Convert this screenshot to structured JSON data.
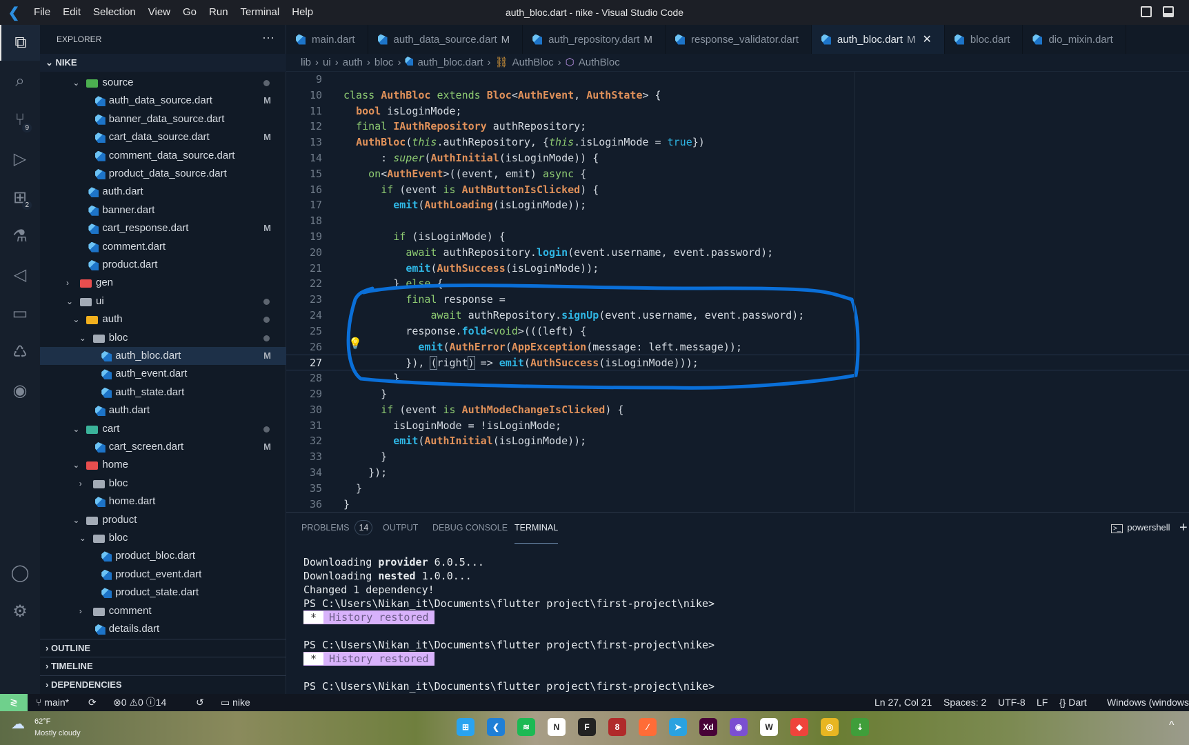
{
  "titlebar": {
    "menu": [
      "File",
      "Edit",
      "Selection",
      "View",
      "Go",
      "Run",
      "Terminal",
      "Help"
    ],
    "title": "auth_bloc.dart - nike - Visual Studio Code"
  },
  "activity": {
    "items": [
      {
        "name": "explorer",
        "glyph": "⧉",
        "active": true
      },
      {
        "name": "search",
        "glyph": "⌕"
      },
      {
        "name": "source-control",
        "glyph": "⑂",
        "badge": "9"
      },
      {
        "name": "run-debug",
        "glyph": "▷"
      },
      {
        "name": "extensions",
        "glyph": "⊞",
        "badge": "2"
      },
      {
        "name": "testing",
        "glyph": "⚗"
      },
      {
        "name": "flutter",
        "glyph": "◁"
      },
      {
        "name": "folder",
        "glyph": "▭"
      },
      {
        "name": "remote-explorer",
        "glyph": "♺"
      },
      {
        "name": "github",
        "glyph": "◉"
      }
    ],
    "bottom": [
      {
        "name": "account",
        "glyph": "◯"
      },
      {
        "name": "settings",
        "glyph": "⚙"
      }
    ]
  },
  "sidebar": {
    "title": "EXPLORER",
    "more": "···",
    "root": "NIKE",
    "tree": [
      {
        "label": "source",
        "depth": 1,
        "kind": "folder",
        "open": true,
        "dot": true,
        "color": "#4caf50"
      },
      {
        "label": "auth_data_source.dart",
        "depth": 2,
        "kind": "file",
        "status": "M"
      },
      {
        "label": "banner_data_source.dart",
        "depth": 2,
        "kind": "file"
      },
      {
        "label": "cart_data_source.dart",
        "depth": 2,
        "kind": "file",
        "status": "M"
      },
      {
        "label": "comment_data_source.dart",
        "depth": 2,
        "kind": "file"
      },
      {
        "label": "product_data_source.dart",
        "depth": 2,
        "kind": "file"
      },
      {
        "label": "auth.dart",
        "depth": 1,
        "kind": "file"
      },
      {
        "label": "banner.dart",
        "depth": 1,
        "kind": "file"
      },
      {
        "label": "cart_response.dart",
        "depth": 1,
        "kind": "file",
        "status": "M"
      },
      {
        "label": "comment.dart",
        "depth": 1,
        "kind": "file"
      },
      {
        "label": "product.dart",
        "depth": 1,
        "kind": "file"
      },
      {
        "label": "gen",
        "depth": 0,
        "kind": "folder",
        "open": false,
        "color": "#e84e4e"
      },
      {
        "label": "ui",
        "depth": 0,
        "kind": "folder",
        "open": true,
        "dot": true
      },
      {
        "label": "auth",
        "depth": 1,
        "kind": "folder",
        "open": true,
        "dot": true,
        "color": "#f2b01e"
      },
      {
        "label": "bloc",
        "depth": 2,
        "kind": "folder",
        "open": true,
        "dot": true
      },
      {
        "label": "auth_bloc.dart",
        "depth": 3,
        "kind": "file",
        "status": "M",
        "selected": true
      },
      {
        "label": "auth_event.dart",
        "depth": 3,
        "kind": "file"
      },
      {
        "label": "auth_state.dart",
        "depth": 3,
        "kind": "file"
      },
      {
        "label": "auth.dart",
        "depth": 2,
        "kind": "file"
      },
      {
        "label": "cart",
        "depth": 1,
        "kind": "folder",
        "open": true,
        "dot": true,
        "color": "#3bb39a"
      },
      {
        "label": "cart_screen.dart",
        "depth": 2,
        "kind": "file",
        "status": "M"
      },
      {
        "label": "home",
        "depth": 1,
        "kind": "folder",
        "open": true,
        "color": "#e84e4e"
      },
      {
        "label": "bloc",
        "depth": 2,
        "kind": "folder",
        "open": false
      },
      {
        "label": "home.dart",
        "depth": 2,
        "kind": "file"
      },
      {
        "label": "product",
        "depth": 1,
        "kind": "folder",
        "open": true
      },
      {
        "label": "bloc",
        "depth": 2,
        "kind": "folder",
        "open": true
      },
      {
        "label": "product_bloc.dart",
        "depth": 3,
        "kind": "file"
      },
      {
        "label": "product_event.dart",
        "depth": 3,
        "kind": "file"
      },
      {
        "label": "product_state.dart",
        "depth": 3,
        "kind": "file"
      },
      {
        "label": "comment",
        "depth": 2,
        "kind": "folder",
        "open": false
      },
      {
        "label": "details.dart",
        "depth": 2,
        "kind": "file"
      }
    ],
    "sections": [
      "OUTLINE",
      "TIMELINE",
      "DEPENDENCIES"
    ]
  },
  "tabs": [
    {
      "label": "main.dart"
    },
    {
      "label": "auth_data_source.dart",
      "status": "M"
    },
    {
      "label": "auth_repository.dart",
      "status": "M"
    },
    {
      "label": "response_validator.dart"
    },
    {
      "label": "auth_bloc.dart",
      "status": "M",
      "active": true,
      "close": "✕"
    },
    {
      "label": "bloc.dart"
    },
    {
      "label": "dio_mixin.dart"
    }
  ],
  "breadcrumb": [
    "lib",
    "ui",
    "auth",
    "bloc",
    "auth_bloc.dart",
    "AuthBloc",
    "AuthBloc"
  ],
  "editor": {
    "current_line": 27,
    "lines": [
      {
        "n": "9",
        "t": []
      },
      {
        "n": "10",
        "t": [
          [
            "class ",
            "kw"
          ],
          [
            "AuthBloc",
            "ty"
          ],
          [
            " extends ",
            "kw"
          ],
          [
            "Bloc",
            "ty"
          ],
          [
            "<",
            "pl"
          ],
          [
            "AuthEvent",
            "ty"
          ],
          [
            ", ",
            "pl"
          ],
          [
            "AuthState",
            "ty"
          ],
          [
            "> {",
            "pl"
          ]
        ]
      },
      {
        "n": "11",
        "t": [
          [
            "  ",
            "pl"
          ],
          [
            "bool",
            "ty"
          ],
          [
            " isLoginMode;",
            "pl"
          ]
        ]
      },
      {
        "n": "12",
        "t": [
          [
            "  ",
            "pl"
          ],
          [
            "final ",
            "kw"
          ],
          [
            "IAuthRepository",
            "ty"
          ],
          [
            " authRepository;",
            "pl"
          ]
        ]
      },
      {
        "n": "13",
        "t": [
          [
            "  ",
            "pl"
          ],
          [
            "AuthBloc",
            "ty"
          ],
          [
            "(",
            "pl"
          ],
          [
            "this",
            "it"
          ],
          [
            ".authRepository, {",
            "pl"
          ],
          [
            "this",
            "it"
          ],
          [
            ".isLoginMode = ",
            "pl"
          ],
          [
            "true",
            "lit"
          ],
          [
            "})",
            "pl"
          ]
        ]
      },
      {
        "n": "14",
        "t": [
          [
            "      : ",
            "pl"
          ],
          [
            "super",
            "it"
          ],
          [
            "(",
            "pl"
          ],
          [
            "AuthInitial",
            "ty"
          ],
          [
            "(isLoginMode)) {",
            "pl"
          ]
        ]
      },
      {
        "n": "15",
        "t": [
          [
            "    ",
            "pl"
          ],
          [
            "on",
            "kw"
          ],
          [
            "<",
            "pl"
          ],
          [
            "AuthEvent",
            "ty"
          ],
          [
            ">((event, emit) ",
            "pl"
          ],
          [
            "async",
            "kw"
          ],
          [
            " {",
            "pl"
          ]
        ]
      },
      {
        "n": "16",
        "t": [
          [
            "      ",
            "pl"
          ],
          [
            "if",
            "kw"
          ],
          [
            " (event ",
            "pl"
          ],
          [
            "is ",
            "kw"
          ],
          [
            "AuthButtonIsClicked",
            "ty"
          ],
          [
            ") {",
            "pl"
          ]
        ]
      },
      {
        "n": "17",
        "t": [
          [
            "        ",
            "pl"
          ],
          [
            "emit",
            "fn"
          ],
          [
            "(",
            "pl"
          ],
          [
            "AuthLoading",
            "ty"
          ],
          [
            "(isLoginMode));",
            "pl"
          ]
        ]
      },
      {
        "n": "18",
        "t": []
      },
      {
        "n": "19",
        "t": [
          [
            "        ",
            "pl"
          ],
          [
            "if",
            "kw"
          ],
          [
            " (isLoginMode) {",
            "pl"
          ]
        ]
      },
      {
        "n": "20",
        "t": [
          [
            "          ",
            "pl"
          ],
          [
            "await",
            "kw"
          ],
          [
            " authRepository.",
            "pl"
          ],
          [
            "login",
            "fn"
          ],
          [
            "(event.username, event.password);",
            "pl"
          ]
        ]
      },
      {
        "n": "21",
        "t": [
          [
            "          ",
            "pl"
          ],
          [
            "emit",
            "fn"
          ],
          [
            "(",
            "pl"
          ],
          [
            "AuthSuccess",
            "ty"
          ],
          [
            "(isLoginMode));",
            "pl"
          ]
        ]
      },
      {
        "n": "22",
        "t": [
          [
            "        } ",
            "pl"
          ],
          [
            "else",
            "kw"
          ],
          [
            " {",
            "pl"
          ]
        ]
      },
      {
        "n": "23",
        "t": [
          [
            "          ",
            "pl"
          ],
          [
            "final",
            "kw"
          ],
          [
            " response =",
            "pl"
          ]
        ]
      },
      {
        "n": "24",
        "t": [
          [
            "              ",
            "pl"
          ],
          [
            "await",
            "kw"
          ],
          [
            " authRepository.",
            "pl"
          ],
          [
            "signUp",
            "fn"
          ],
          [
            "(event.username, event.password);",
            "pl"
          ]
        ]
      },
      {
        "n": "25",
        "t": [
          [
            "          response.",
            "pl"
          ],
          [
            "fold",
            "fn"
          ],
          [
            "<",
            "pl"
          ],
          [
            "void",
            "kw"
          ],
          [
            ">(((left) {",
            "pl"
          ]
        ]
      },
      {
        "n": "26",
        "t": [
          [
            "            ",
            "pl"
          ],
          [
            "emit",
            "fn"
          ],
          [
            "(",
            "pl"
          ],
          [
            "AuthError",
            "ty"
          ],
          [
            "(",
            "pl"
          ],
          [
            "AppException",
            "ty"
          ],
          [
            "(message: left.message));",
            "pl"
          ]
        ]
      },
      {
        "n": "27",
        "t": [
          [
            "          }), ",
            "pl"
          ],
          [
            "(",
            "br"
          ],
          [
            "right",
            "pl"
          ],
          [
            ")",
            "br"
          ],
          [
            " => ",
            "pl"
          ],
          [
            "emit",
            "fn"
          ],
          [
            "(",
            "pl"
          ],
          [
            "AuthSuccess",
            "ty"
          ],
          [
            "(isLoginMode)));",
            "pl"
          ]
        ]
      },
      {
        "n": "28",
        "t": [
          [
            "        }",
            "pl"
          ]
        ]
      },
      {
        "n": "29",
        "t": [
          [
            "      }",
            "pl"
          ]
        ]
      },
      {
        "n": "30",
        "t": [
          [
            "      ",
            "pl"
          ],
          [
            "if",
            "kw"
          ],
          [
            " (event ",
            "pl"
          ],
          [
            "is ",
            "kw"
          ],
          [
            "AuthModeChangeIsClicked",
            "ty"
          ],
          [
            ") {",
            "pl"
          ]
        ]
      },
      {
        "n": "31",
        "t": [
          [
            "        isLoginMode = !isLoginMode;",
            "pl"
          ]
        ]
      },
      {
        "n": "32",
        "t": [
          [
            "        ",
            "pl"
          ],
          [
            "emit",
            "fn"
          ],
          [
            "(",
            "pl"
          ],
          [
            "AuthInitial",
            "ty"
          ],
          [
            "(isLoginMode));",
            "pl"
          ]
        ]
      },
      {
        "n": "33",
        "t": [
          [
            "      }",
            "pl"
          ]
        ]
      },
      {
        "n": "34",
        "t": [
          [
            "    });",
            "pl"
          ]
        ]
      },
      {
        "n": "35",
        "t": [
          [
            "  }",
            "pl"
          ]
        ]
      },
      {
        "n": "36",
        "t": [
          [
            "}",
            "pl"
          ]
        ]
      }
    ],
    "annotation_color": "#0a6fd8"
  },
  "panel": {
    "tabs": [
      {
        "label": "PROBLEMS",
        "count": "14"
      },
      {
        "label": "OUTPUT"
      },
      {
        "label": "DEBUG CONSOLE"
      },
      {
        "label": "TERMINAL",
        "active": true
      }
    ],
    "shell": "powershell",
    "add": "+",
    "terminal": [
      {
        "pre": "Downloading ",
        "bold": "provider",
        "post": " 6.0.5..."
      },
      {
        "pre": "Downloading ",
        "bold": "nested",
        "post": " 1.0.0..."
      },
      {
        "pre": "Changed 1 dependency!"
      },
      {
        "pre": "PS C:\\Users\\Nikan_it\\Documents\\flutter project\\first-project\\nike>"
      },
      {
        "hist": "History restored",
        "star": "*"
      },
      {
        "pre": ""
      },
      {
        "pre": "PS C:\\Users\\Nikan_it\\Documents\\flutter project\\first-project\\nike>"
      },
      {
        "hist": "History restored",
        "star": "*"
      },
      {
        "pre": ""
      },
      {
        "pre": "PS C:\\Users\\Nikan_it\\Documents\\flutter project\\first-project\\nike>"
      }
    ]
  },
  "statusbar": {
    "remote": "≷",
    "branch": "main*",
    "sync": "⟳",
    "errors": "0",
    "warnings": "0",
    "info": "14",
    "history": "↺",
    "folder": "nike",
    "position": "Ln 27, Col 21",
    "spaces": "Spaces: 2",
    "encoding": "UTF-8",
    "eol": "LF",
    "language": "Dart",
    "platform": "Windows (windows"
  },
  "taskbar": {
    "weather": {
      "temp": "62°F",
      "desc": "Mostly cloudy"
    },
    "apps": [
      {
        "name": "windows-start",
        "color": "#29a3f0",
        "glyph": "⊞"
      },
      {
        "name": "vscode",
        "color": "#1f7fd6",
        "glyph": "❮"
      },
      {
        "name": "spotify",
        "color": "#1db954",
        "glyph": "≋"
      },
      {
        "name": "notion",
        "color": "#ffffff",
        "glyph": "N"
      },
      {
        "name": "figma",
        "color": "#222222",
        "glyph": "F"
      },
      {
        "name": "app-8",
        "color": "#b02a2a",
        "glyph": "8"
      },
      {
        "name": "postman",
        "color": "#ff6c37",
        "glyph": "⁄"
      },
      {
        "name": "telegram",
        "color": "#2aa2e0",
        "glyph": "➤"
      },
      {
        "name": "adobe-xd",
        "color": "#470137",
        "glyph": "Xd"
      },
      {
        "name": "github-desktop",
        "color": "#7b4fd1",
        "glyph": "◉"
      },
      {
        "name": "app-w",
        "color": "#ffffff",
        "glyph": "W"
      },
      {
        "name": "anydesk",
        "color": "#ef443b",
        "glyph": "◆"
      },
      {
        "name": "chrome",
        "color": "#e8b622",
        "glyph": "◎"
      },
      {
        "name": "download-manager",
        "color": "#3f9e3a",
        "glyph": "⇣"
      }
    ],
    "tray": "^"
  }
}
